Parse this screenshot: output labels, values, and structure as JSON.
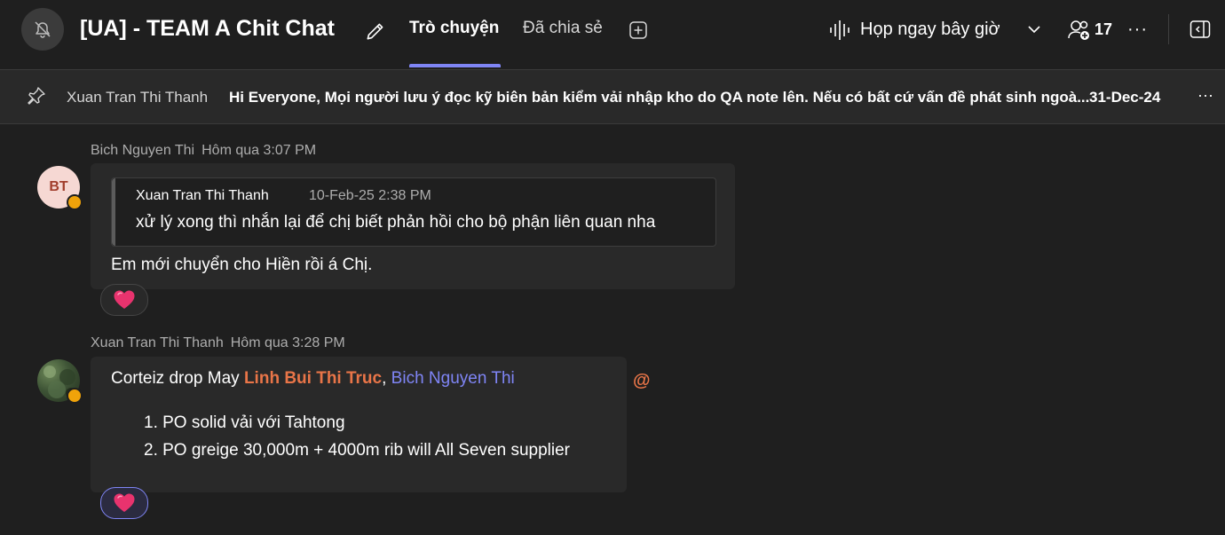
{
  "header": {
    "title": "[UA] - TEAM A Chit Chat",
    "tabs": [
      {
        "label": "Trò chuyện",
        "active": true
      },
      {
        "label": "Đã chia sẻ",
        "active": false
      }
    ],
    "meet_label": "Họp ngay bây giờ",
    "participant_count": "17",
    "more_label": "···"
  },
  "pinned": {
    "author": "Xuan Tran Thi Thanh",
    "text": "Hi Everyone, Mọi người lưu ý đọc kỹ biên bản kiểm vải nhập kho do QA note lên. Nếu có bất cứ vấn đề phát sinh ngoà...",
    "date": "31-Dec-24",
    "more_label": "···"
  },
  "messages": [
    {
      "author": "Bich Nguyen Thi",
      "time": "Hôm qua 3:07 PM",
      "avatar_initials": "BT",
      "quote": {
        "author": "Xuan Tran Thi Thanh",
        "time": "10-Feb-25 2:38 PM",
        "text": "xử lý xong thì nhắn lại để chị biết phản hồi cho bộ phận liên quan nha"
      },
      "text": "Em mới chuyển cho Hiền rồi á Chị.",
      "reaction": "♥"
    },
    {
      "author": "Xuan Tran Thi Thanh",
      "time": "Hôm qua 3:28 PM",
      "text_prefix": "Corteiz drop May ",
      "mention_1": "Linh Bui Thi Truc",
      "separator": ", ",
      "mention_2": "Bich Nguyen Thi",
      "list": [
        "1. PO solid vải với Tahtong",
        "2. PO greige 30,000m + 4000m rib will All Seven supplier"
      ],
      "mention_indicator": "@",
      "reaction": "♥"
    }
  ],
  "colors": {
    "background": "#1f1f1f",
    "bubble": "#292929",
    "accent": "#7f85f5",
    "mention_self": "#e97548",
    "status_away": "#f0a30a",
    "heart": "#e8336e"
  },
  "icons": [
    "bell-muted-icon",
    "edit-icon",
    "add-tab-icon",
    "audio-wave-icon",
    "chevron-down-icon",
    "add-people-icon",
    "more-icon",
    "side-panel-icon",
    "pin-icon",
    "heart-icon",
    "at-icon"
  ]
}
